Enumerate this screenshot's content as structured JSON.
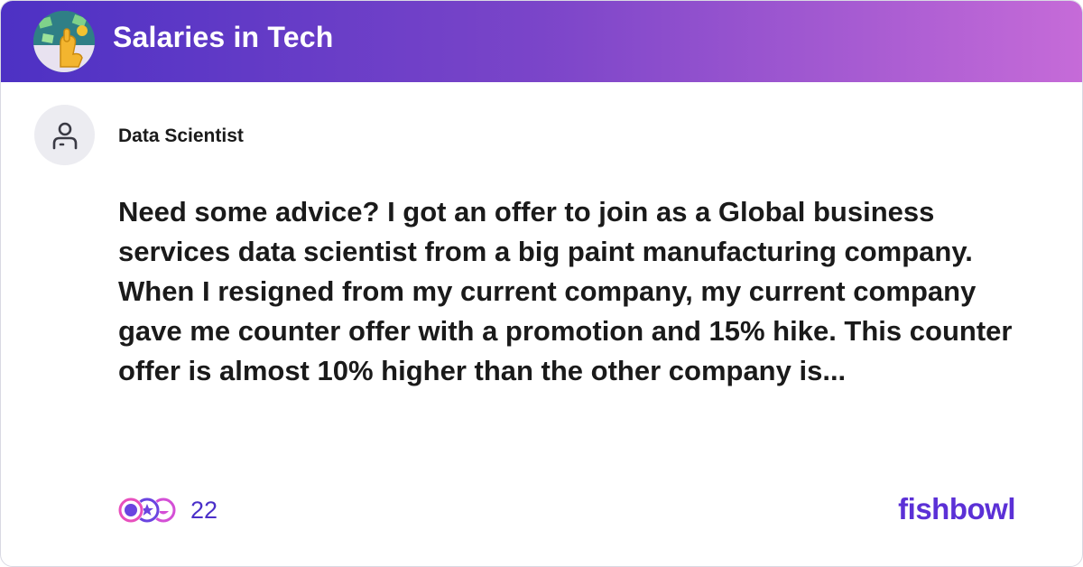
{
  "header": {
    "bowl_name": "Salaries in Tech",
    "bowl_icon": "bowl-avatar-icon",
    "gradient_colors": [
      "#4d31c4",
      "#7b45c9",
      "#c66bd8"
    ]
  },
  "post": {
    "author_title": "Data Scientist",
    "author_icon": "user-icon",
    "body": "Need some advice? I got an offer to join as a Global business services data scientist from a big paint manufacturing company. When I resigned from my current company, my current company gave me counter offer with a promotion and 15% hike. This counter offer is almost 10% higher than the other company is..."
  },
  "footer": {
    "reaction_icons": [
      "heart-reaction-icon",
      "star-reaction-icon",
      "laugh-reaction-icon"
    ],
    "reaction_count": "22",
    "brand": "fishbowl",
    "brand_color": "#5b30d6"
  }
}
